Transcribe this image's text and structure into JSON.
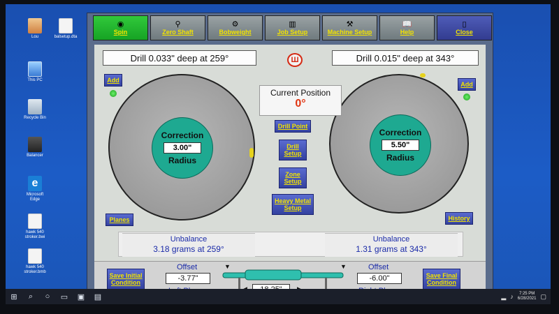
{
  "desktop": {
    "icons": [
      {
        "label": "Lou"
      },
      {
        "label": "balsetup.dta"
      },
      {
        "label": "This PC"
      },
      {
        "label": "Recycle Bin"
      },
      {
        "label": "Balancer"
      },
      {
        "label": "Microsoft Edge"
      },
      {
        "label": "hawk 540 stroker.bwi"
      },
      {
        "label": "hawk 540 stroker.bmb"
      }
    ]
  },
  "toolbar": {
    "items": [
      {
        "label": "Spin",
        "icon": "spin-icon"
      },
      {
        "label": "Zero Shaft",
        "icon": "zero-shaft-icon"
      },
      {
        "label": "Bobweight",
        "icon": "bobweight-icon"
      },
      {
        "label": "Job Setup",
        "icon": "job-setup-icon"
      },
      {
        "label": "Machine Setup",
        "icon": "machine-setup-icon"
      },
      {
        "label": "Help",
        "icon": "help-icon"
      },
      {
        "label": "Close",
        "icon": "close-door-icon"
      }
    ]
  },
  "left": {
    "drill_text": "Drill 0.033\" deep at 259°",
    "add_label": "Add",
    "correction_title": "Correction",
    "correction_value": "3.00\"",
    "correction_sub": "Radius",
    "planes_label": "Planes",
    "unbalance_title": "Unbalance",
    "unbalance_value": "3.18 grams at 259°",
    "offset_title": "Offset",
    "offset_value": "-3.77\"",
    "plane_label": "Left Plane",
    "save_label": "Save Initial Condition"
  },
  "right": {
    "drill_text": "Drill 0.015\" deep at 343°",
    "add_label": "Add",
    "correction_title": "Correction",
    "correction_value": "5.50\"",
    "correction_sub": "Radius",
    "history_label": "History",
    "unbalance_title": "Unbalance",
    "unbalance_value": "1.31 grams at 343°",
    "offset_title": "Offset",
    "offset_value": "-6.00\"",
    "plane_label": "Right Plane",
    "save_label": "Save Final Condition"
  },
  "center": {
    "position_title": "Current Position",
    "position_value": "0°",
    "buttons": [
      "Drill Point",
      "Drill Setup",
      "Zone Setup",
      "Heavy Metal Setup"
    ],
    "shaft_length": "18.25\""
  },
  "taskbar": {
    "time": "7:25 PM",
    "date": "6/28/2021"
  },
  "colors": {
    "accent_green": "#16a324",
    "button_blue": "#3442a0",
    "label_yellow": "#f3e400",
    "correction_teal": "#1ea991",
    "position_red": "#e03512"
  }
}
